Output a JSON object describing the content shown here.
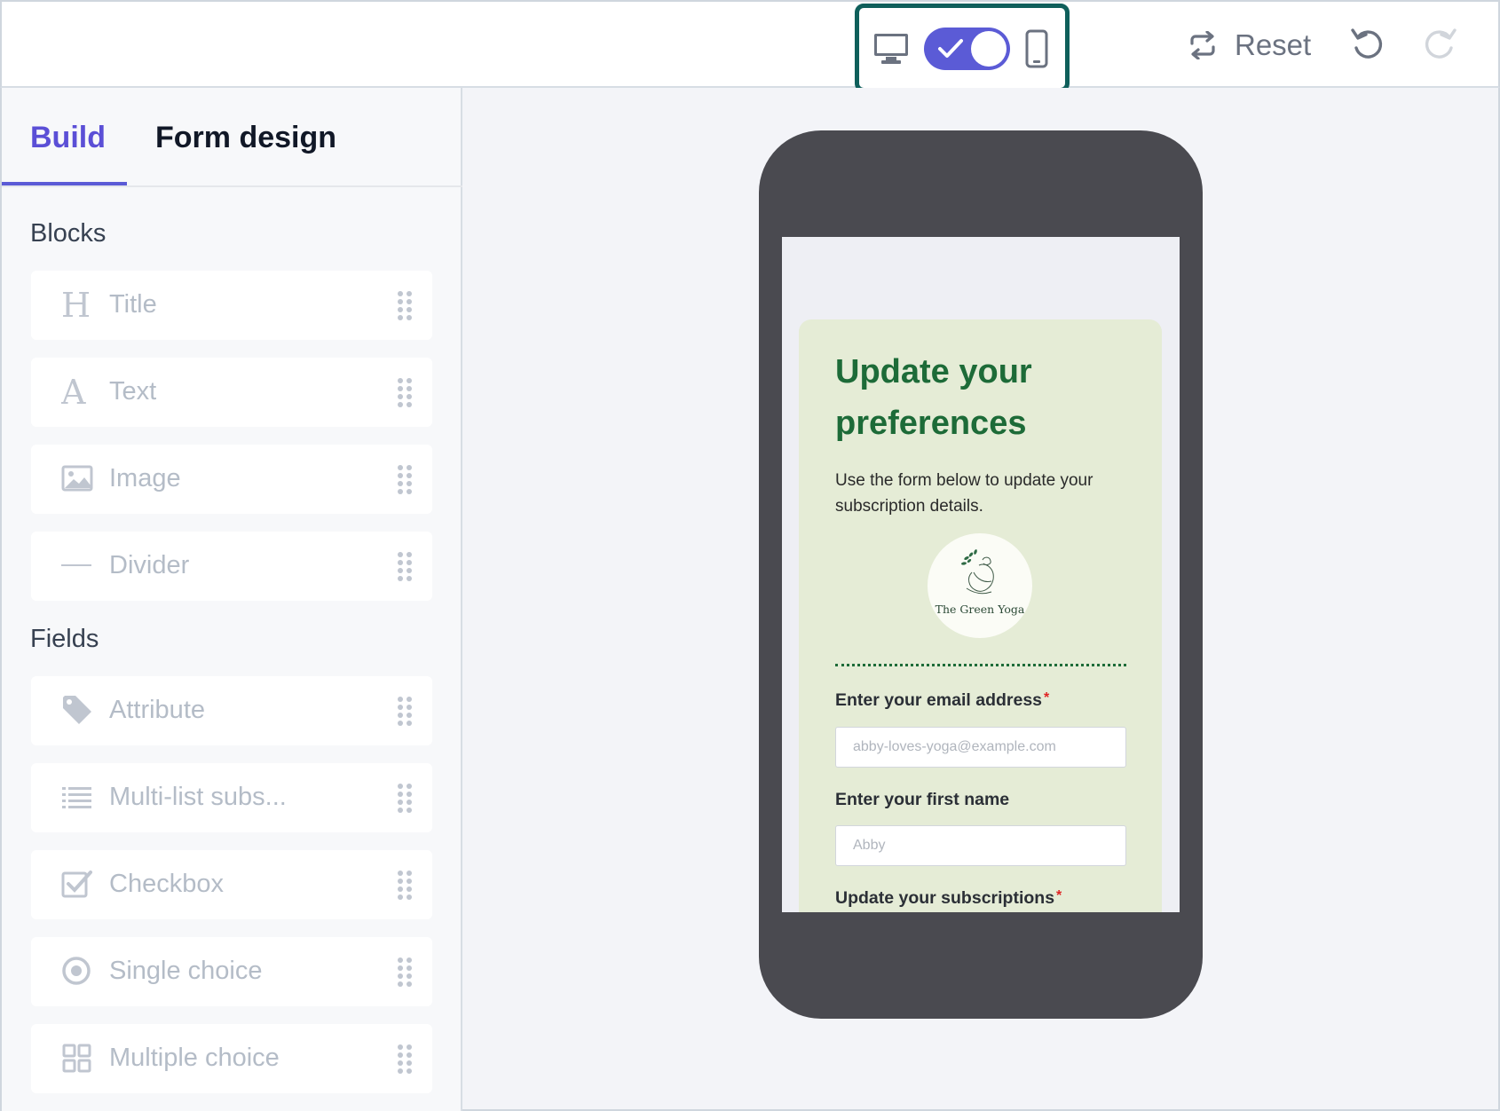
{
  "toolbar": {
    "desktop_icon": "desktop-icon",
    "mobile_toggle_on": true,
    "mobile_icon": "mobile-icon",
    "reset_label": "Reset",
    "undo_icon": "undo-icon",
    "redo_icon": "redo-icon"
  },
  "sidebar": {
    "tabs": [
      {
        "label": "Build",
        "active": true
      },
      {
        "label": "Form design",
        "active": false
      }
    ],
    "blocks_label": "Blocks",
    "blocks": [
      {
        "label": "Title",
        "icon": "heading-icon"
      },
      {
        "label": "Text",
        "icon": "text-icon"
      },
      {
        "label": "Image",
        "icon": "image-icon"
      },
      {
        "label": "Divider",
        "icon": "divider-icon"
      }
    ],
    "fields_label": "Fields",
    "fields": [
      {
        "label": "Attribute",
        "icon": "tag-icon"
      },
      {
        "label": "Multi-list subs...",
        "icon": "list-icon"
      },
      {
        "label": "Checkbox",
        "icon": "checkbox-icon"
      },
      {
        "label": "Single choice",
        "icon": "radio-icon"
      },
      {
        "label": "Multiple choice",
        "icon": "grid-icon"
      }
    ]
  },
  "preview": {
    "title": "Update your preferences",
    "description": "Use the form below to update your subscription details.",
    "logo_text": "The Green Yoga",
    "email_label": "Enter your email address",
    "email_required": "*",
    "email_placeholder": "abby-loves-yoga@example.com",
    "firstname_label": "Enter your first name",
    "firstname_placeholder": "Abby",
    "subscriptions_label": "Update your subscriptions",
    "subscriptions_required": "*"
  },
  "colors": {
    "accent": "#5b5bd6",
    "highlight_border": "#0f5f5b",
    "form_bg": "#e5ecd6",
    "form_title": "#1d6b38",
    "phone": "#4a4a50"
  }
}
